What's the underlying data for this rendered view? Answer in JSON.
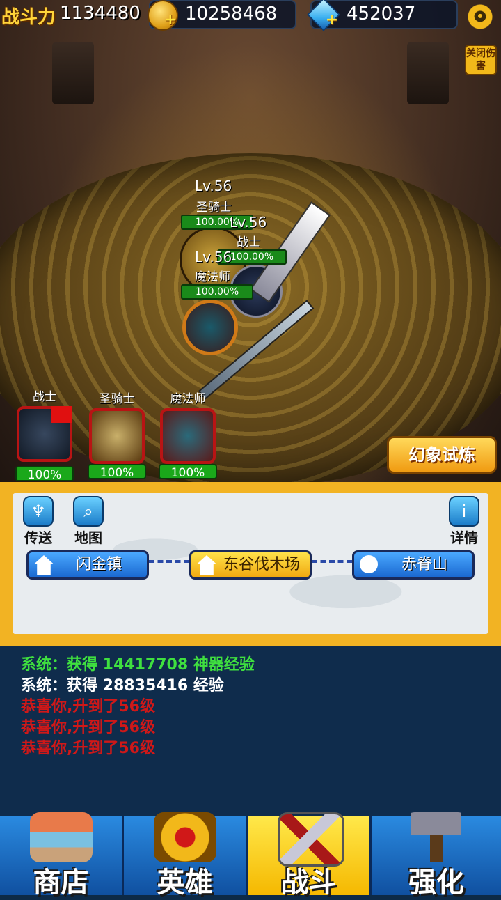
{
  "hud": {
    "power_label": "战斗力",
    "power_value": "1134480",
    "gold_value": "10258468",
    "gems_value": "452037",
    "damage_toggle": "关闭伤害",
    "settings_icon": "gear-icon"
  },
  "battle_units": [
    {
      "level": "Lv.56",
      "name": "圣骑士",
      "hp": "100.00%"
    },
    {
      "level": "Lv.56",
      "name": "战士",
      "hp": "100.00%"
    },
    {
      "level": "Lv.56",
      "name": "魔法师",
      "hp": "100.00%"
    }
  ],
  "party": [
    {
      "name": "战士",
      "hp": "100%"
    },
    {
      "name": "圣骑士",
      "hp": "100%"
    },
    {
      "name": "魔法师",
      "hp": "100%"
    }
  ],
  "trial_button": "幻象试炼",
  "map": {
    "teleport_label": "传送",
    "map_label": "地图",
    "details_label": "详情",
    "locations": [
      "闪金镇",
      "东谷伐木场",
      "赤脊山"
    ]
  },
  "chat": [
    {
      "text": "系统：获得 14417708 神器经验",
      "color": "#3fe03f"
    },
    {
      "text": "系统：获得 28835416 经验",
      "color": "#ffffff"
    },
    {
      "text": "恭喜你,升到了56级",
      "color": "#d01818"
    },
    {
      "text": "恭喜你,升到了56级",
      "color": "#d01818"
    },
    {
      "text": "恭喜你,升到了56级",
      "color": "#d01818"
    }
  ],
  "nav": {
    "shop": "商店",
    "heroes": "英雄",
    "battle": "战斗",
    "enhance": "强化",
    "active": "battle"
  }
}
